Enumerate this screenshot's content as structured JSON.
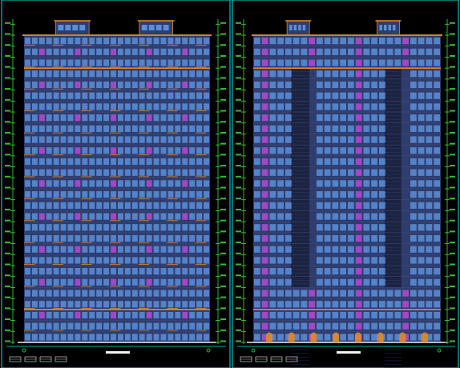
{
  "drawing": {
    "background": "#000000",
    "colors": {
      "frame": "#00e5ee",
      "dim": "#37e637",
      "roof": "#e08a2a",
      "wall": "#2f3c6e",
      "window": "#5b8fd9",
      "window_alt": "#b64ad6",
      "wall_dark": "#1c2340",
      "ground": "#f0f0f0",
      "title_bar": "#f2f2f2",
      "label": "#37e637"
    }
  },
  "sheets": [
    {
      "id": "front",
      "title_label": "",
      "floors": 28
    },
    {
      "id": "rear",
      "title_label": "",
      "floors": 28
    }
  ]
}
